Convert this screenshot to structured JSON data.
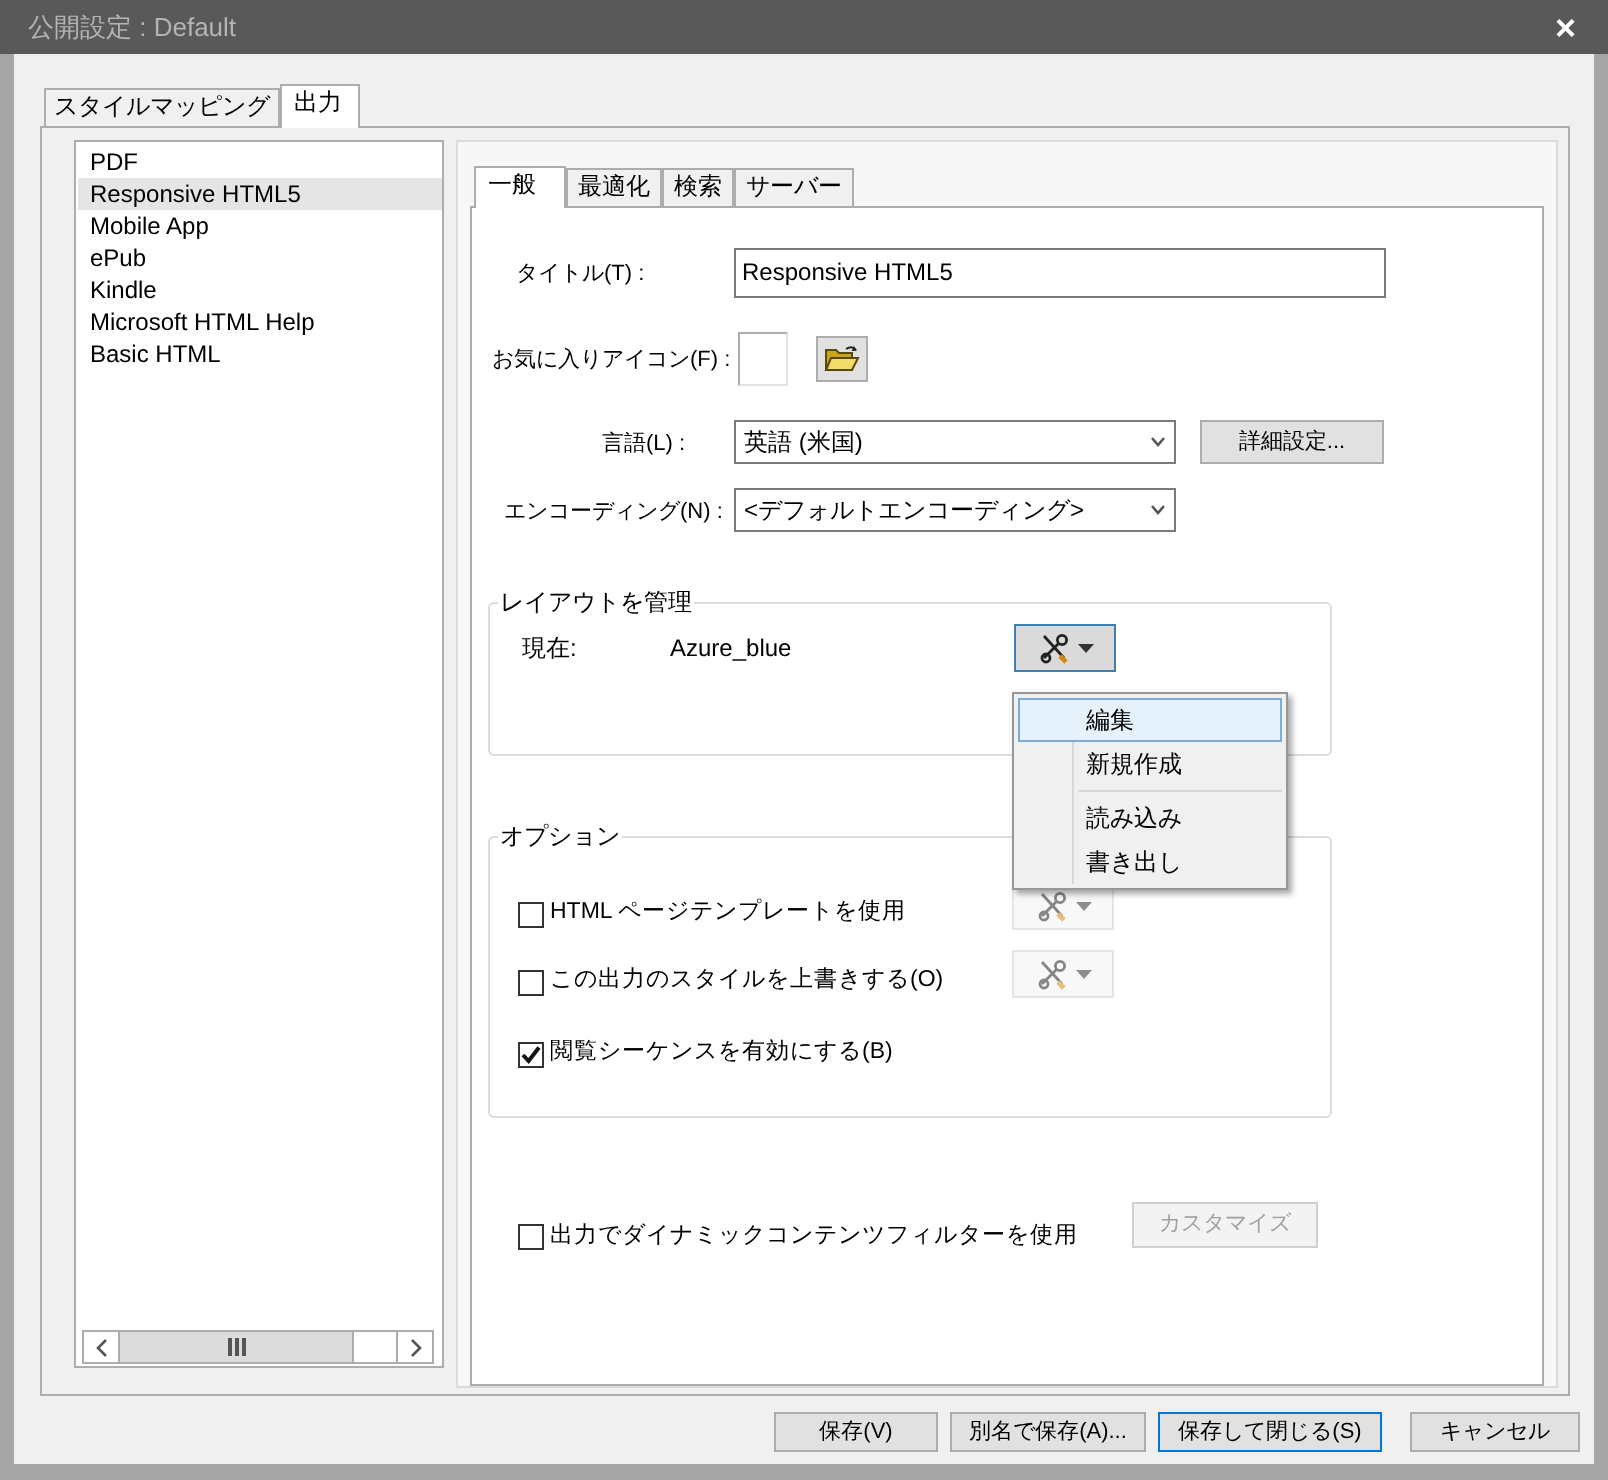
{
  "window": {
    "title": "公開設定 : Default",
    "close": "×"
  },
  "outer_tabs": [
    {
      "label": "スタイルマッピング",
      "selected": false
    },
    {
      "label": "出力",
      "selected": true
    }
  ],
  "outputs": [
    {
      "label": "PDF",
      "selected": false
    },
    {
      "label": "Responsive HTML5",
      "selected": true
    },
    {
      "label": "Mobile App",
      "selected": false
    },
    {
      "label": "ePub",
      "selected": false
    },
    {
      "label": "Kindle",
      "selected": false
    },
    {
      "label": "Microsoft HTML Help",
      "selected": false
    },
    {
      "label": "Basic HTML",
      "selected": false
    }
  ],
  "inner_tabs": [
    {
      "label": "一般",
      "selected": true
    },
    {
      "label": "最適化",
      "selected": false
    },
    {
      "label": "検索",
      "selected": false
    },
    {
      "label": "サーバー",
      "selected": false
    }
  ],
  "general": {
    "title_label": "タイトル(T) :",
    "title_value": "Responsive HTML5",
    "favicon_label": "お気に入りアイコン(F) :",
    "language_label": "言語(L) :",
    "language_value": "英語 (米国)",
    "advanced_button": "詳細設定...",
    "encoding_label": "エンコーディング(N) :",
    "encoding_value": "<デフォルトエンコーディング>"
  },
  "layout_group": {
    "title": "レイアウトを管理",
    "current_label": "現在:",
    "current_value": "Azure_blue",
    "menu_open": true,
    "menu": [
      {
        "label": "編集",
        "selected": true,
        "separator_above": false
      },
      {
        "label": "新規作成",
        "selected": false,
        "separator_above": false
      },
      {
        "label": "読み込み",
        "selected": false,
        "separator_above": true
      },
      {
        "label": "書き出し",
        "selected": false,
        "separator_above": false
      }
    ]
  },
  "options": {
    "title": "オプション",
    "items": [
      {
        "kind": "tool",
        "label": "HTML ページテンプレートを使用",
        "checked": false,
        "tool_disabled": true
      },
      {
        "kind": "tool",
        "label": "この出力のスタイルを上書きする(O)",
        "checked": false,
        "tool_disabled": true
      },
      {
        "kind": "plain",
        "label": "閲覧シーケンスを有効にする(B)",
        "checked": true
      }
    ]
  },
  "dynamic_filter": {
    "label": "出力でダイナミックコンテンツフィルターを使用",
    "checked": false,
    "button": "カスタマイズ",
    "button_disabled": true
  },
  "footer_buttons": [
    {
      "label": "保存(V)",
      "default": false
    },
    {
      "label": "別名で保存(A)...",
      "default": false
    },
    {
      "label": "保存して閉じる(S)",
      "default": true
    },
    {
      "label": "キャンセル",
      "default": false
    }
  ]
}
